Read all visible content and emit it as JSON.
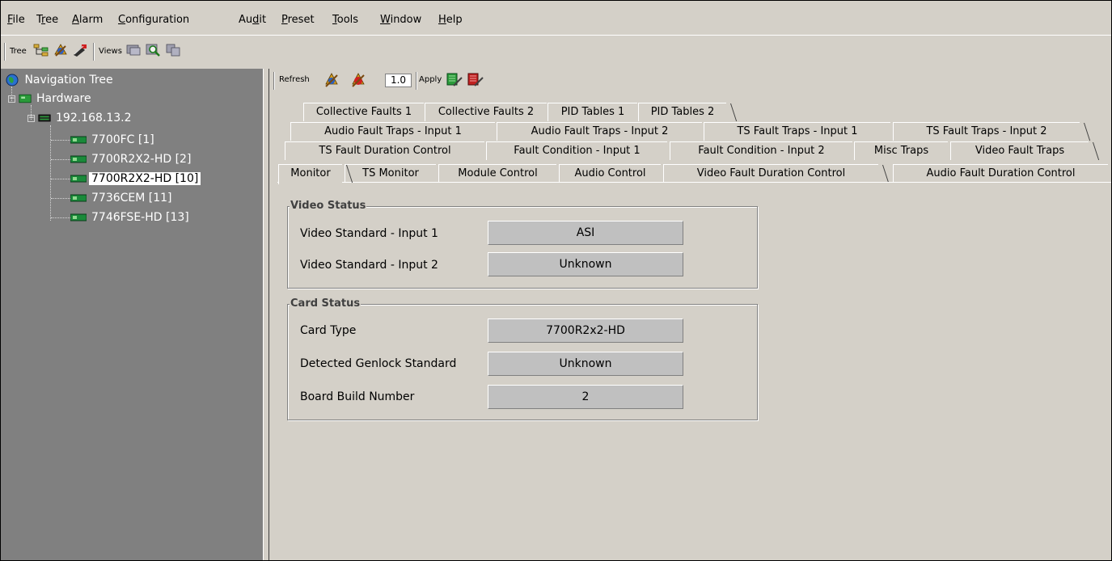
{
  "menu": {
    "items": [
      {
        "label": "File",
        "underline": "F"
      },
      {
        "label": "Tree",
        "underline": "r"
      },
      {
        "label": "Alarm",
        "underline": "A"
      },
      {
        "label": "Configuration",
        "underline": "C"
      },
      {
        "label": "Audit",
        "underline": "d"
      },
      {
        "label": "Preset",
        "underline": "P"
      },
      {
        "label": "Tools",
        "underline": "T"
      },
      {
        "label": "Window",
        "underline": "W"
      },
      {
        "label": "Help",
        "underline": "H"
      }
    ]
  },
  "toolbar": {
    "tree_label": "Tree",
    "views_label": "Views",
    "icons": [
      "tree-hierarchy-icon",
      "refresh-tree-icon",
      "edit-tree-icon",
      "view-icon",
      "search-view-icon",
      "copy-view-icon"
    ]
  },
  "tree": {
    "root": "Navigation Tree",
    "hardware": "Hardware",
    "host": "192.168.13.2",
    "cards": [
      {
        "label": "7700FC  [1]",
        "selected": false
      },
      {
        "label": "7700R2X2-HD  [2]",
        "selected": false
      },
      {
        "label": "7700R2X2-HD  [10]",
        "selected": true
      },
      {
        "label": "7736CEM  [11]",
        "selected": false
      },
      {
        "label": "7746FSE-HD  [13]",
        "selected": false
      }
    ]
  },
  "panel_toolbar": {
    "refresh_label": "Refresh",
    "rate_value": "1.0",
    "apply_label": "Apply"
  },
  "tabs": {
    "row1": [
      "Collective Faults 1",
      "Collective Faults 2",
      "PID Tables 1",
      "PID Tables 2"
    ],
    "row2": [
      "Audio Fault Traps - Input 1",
      "Audio Fault Traps - Input 2",
      "TS Fault Traps - Input 1",
      "TS Fault Traps - Input 2"
    ],
    "row3": [
      "TS Fault Duration Control",
      "Fault Condition - Input 1",
      "Fault Condition - Input 2",
      "Misc Traps",
      "Video Fault Traps"
    ],
    "row4": [
      "Monitor",
      "TS Monitor",
      "Module Control",
      "Audio Control",
      "Video Fault Duration Control",
      "Audio Fault Duration Control"
    ],
    "active": "Monitor"
  },
  "video_status": {
    "title": "Video Status",
    "input1_label": "Video Standard - Input 1",
    "input1_value": "ASI",
    "input2_label": "Video Standard - Input 2",
    "input2_value": "Unknown"
  },
  "card_status": {
    "title": "Card Status",
    "card_type_label": "Card Type",
    "card_type_value": "7700R2x2-HD",
    "genlock_label": "Detected Genlock Standard",
    "genlock_value": "Unknown",
    "build_label": "Board Build Number",
    "build_value": "2"
  },
  "colors": {
    "tree_bg": "#808080",
    "chrome": "#d4d0c8",
    "card_icon": "#1a8a3a"
  }
}
